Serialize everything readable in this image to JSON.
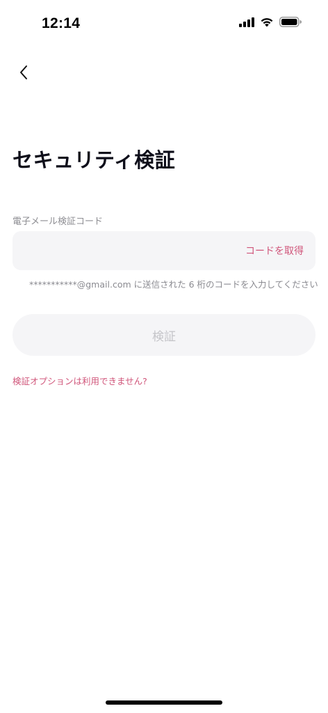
{
  "status_bar": {
    "time": "12:14",
    "icons": [
      "cellular-signal-icon",
      "wifi-icon",
      "battery-icon"
    ]
  },
  "nav": {
    "back_icon": "chevron-left-icon"
  },
  "page": {
    "title": "セキュリティ検証"
  },
  "form": {
    "field_label": "電子メール検証コード",
    "code_value": "",
    "get_code_label": "コードを取得",
    "hint": "***********@gmail.com に送信された 6 桁のコードを入力してください",
    "verify_label": "検証",
    "help_link": "検証オプションは利用できません?"
  },
  "colors": {
    "accent": "#d0557a",
    "field_bg": "#f5f5f7",
    "disabled_text": "#c4c4c8"
  }
}
